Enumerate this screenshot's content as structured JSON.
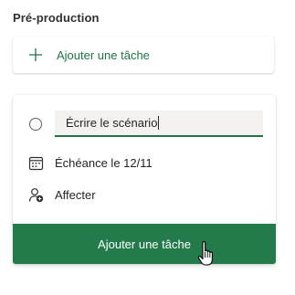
{
  "bucket": {
    "title": "Pré-production"
  },
  "add_task": {
    "label": "Ajouter une tâche",
    "icon": "plus-icon"
  },
  "new_task": {
    "title_value": "Écrire le scénario",
    "due_label": "Échéance le 12/11",
    "due_icon": "calendar-icon",
    "assign_label": "Affecter",
    "assign_icon": "add-person-icon",
    "submit_label": "Ajouter une tâche"
  },
  "colors": {
    "accent": "#217346",
    "submit_background": "#237b4b",
    "submit_text": "#ffffff",
    "text": "#252423"
  }
}
